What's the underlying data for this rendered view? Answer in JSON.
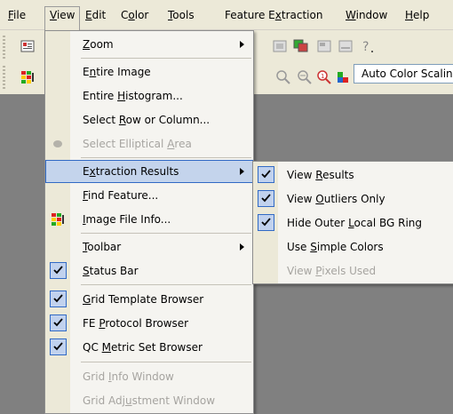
{
  "menubar": [
    {
      "pre": "",
      "key": "F",
      "post": "ile"
    },
    {
      "pre": "",
      "key": "V",
      "post": "iew"
    },
    {
      "pre": "",
      "key": "E",
      "post": "dit"
    },
    {
      "pre": "C",
      "key": "o",
      "post": "lor"
    },
    {
      "pre": "",
      "key": "T",
      "post": "ools"
    },
    {
      "pre": "Feature E",
      "key": "x",
      "post": "traction"
    },
    {
      "pre": "",
      "key": "W",
      "post": "indow"
    },
    {
      "pre": "",
      "key": "H",
      "post": "elp"
    }
  ],
  "toolbar": {
    "color_scaling": "Auto Color Scaling"
  },
  "view_menu": [
    {
      "pre": "",
      "key": "Z",
      "post": "oom",
      "submenu": true
    },
    {
      "pre": "E",
      "key": "n",
      "post": "tire Image"
    },
    {
      "pre": "Entire ",
      "key": "H",
      "post": "istogram..."
    },
    {
      "pre": "Select ",
      "key": "R",
      "post": "ow or Column..."
    },
    {
      "pre": "Select Elliptical ",
      "key": "A",
      "post": "rea",
      "disabled": true
    },
    {
      "pre": "E",
      "key": "x",
      "post": "traction Results",
      "submenu": true,
      "highlighted": true
    },
    {
      "pre": "",
      "key": "F",
      "post": "ind Feature..."
    },
    {
      "pre": "",
      "key": "I",
      "post": "mage File Info..."
    },
    {
      "pre": "",
      "key": "T",
      "post": "oolbar",
      "submenu": true
    },
    {
      "pre": "",
      "key": "S",
      "post": "tatus Bar",
      "checked": true
    },
    {
      "pre": "",
      "key": "G",
      "post": "rid Template Browser",
      "checked": true
    },
    {
      "pre": "FE ",
      "key": "P",
      "post": "rotocol Browser",
      "checked": true
    },
    {
      "pre": "QC ",
      "key": "M",
      "post": "etric Set Browser",
      "checked": true
    },
    {
      "pre": "Grid ",
      "key": "I",
      "post": "nfo Window",
      "disabled": true
    },
    {
      "pre": "Grid Adj",
      "key": "u",
      "post": "stment Window",
      "disabled": true
    }
  ],
  "submenu": [
    {
      "pre": "View ",
      "key": "R",
      "post": "esults",
      "checked": true
    },
    {
      "pre": "View ",
      "key": "O",
      "post": "utliers Only",
      "checked": true
    },
    {
      "pre": "Hide Outer ",
      "key": "L",
      "post": "ocal BG Ring",
      "checked": true
    },
    {
      "pre": "Use ",
      "key": "S",
      "post": "imple Colors"
    },
    {
      "pre": "View ",
      "key": "P",
      "post": "ixels Used",
      "disabled": true
    }
  ],
  "icons": [
    "props-icon",
    "image-info-icon",
    "zoom-in-icon",
    "zoom-out-icon",
    "zoom-fit-icon",
    "color-icon",
    "help-icon"
  ]
}
